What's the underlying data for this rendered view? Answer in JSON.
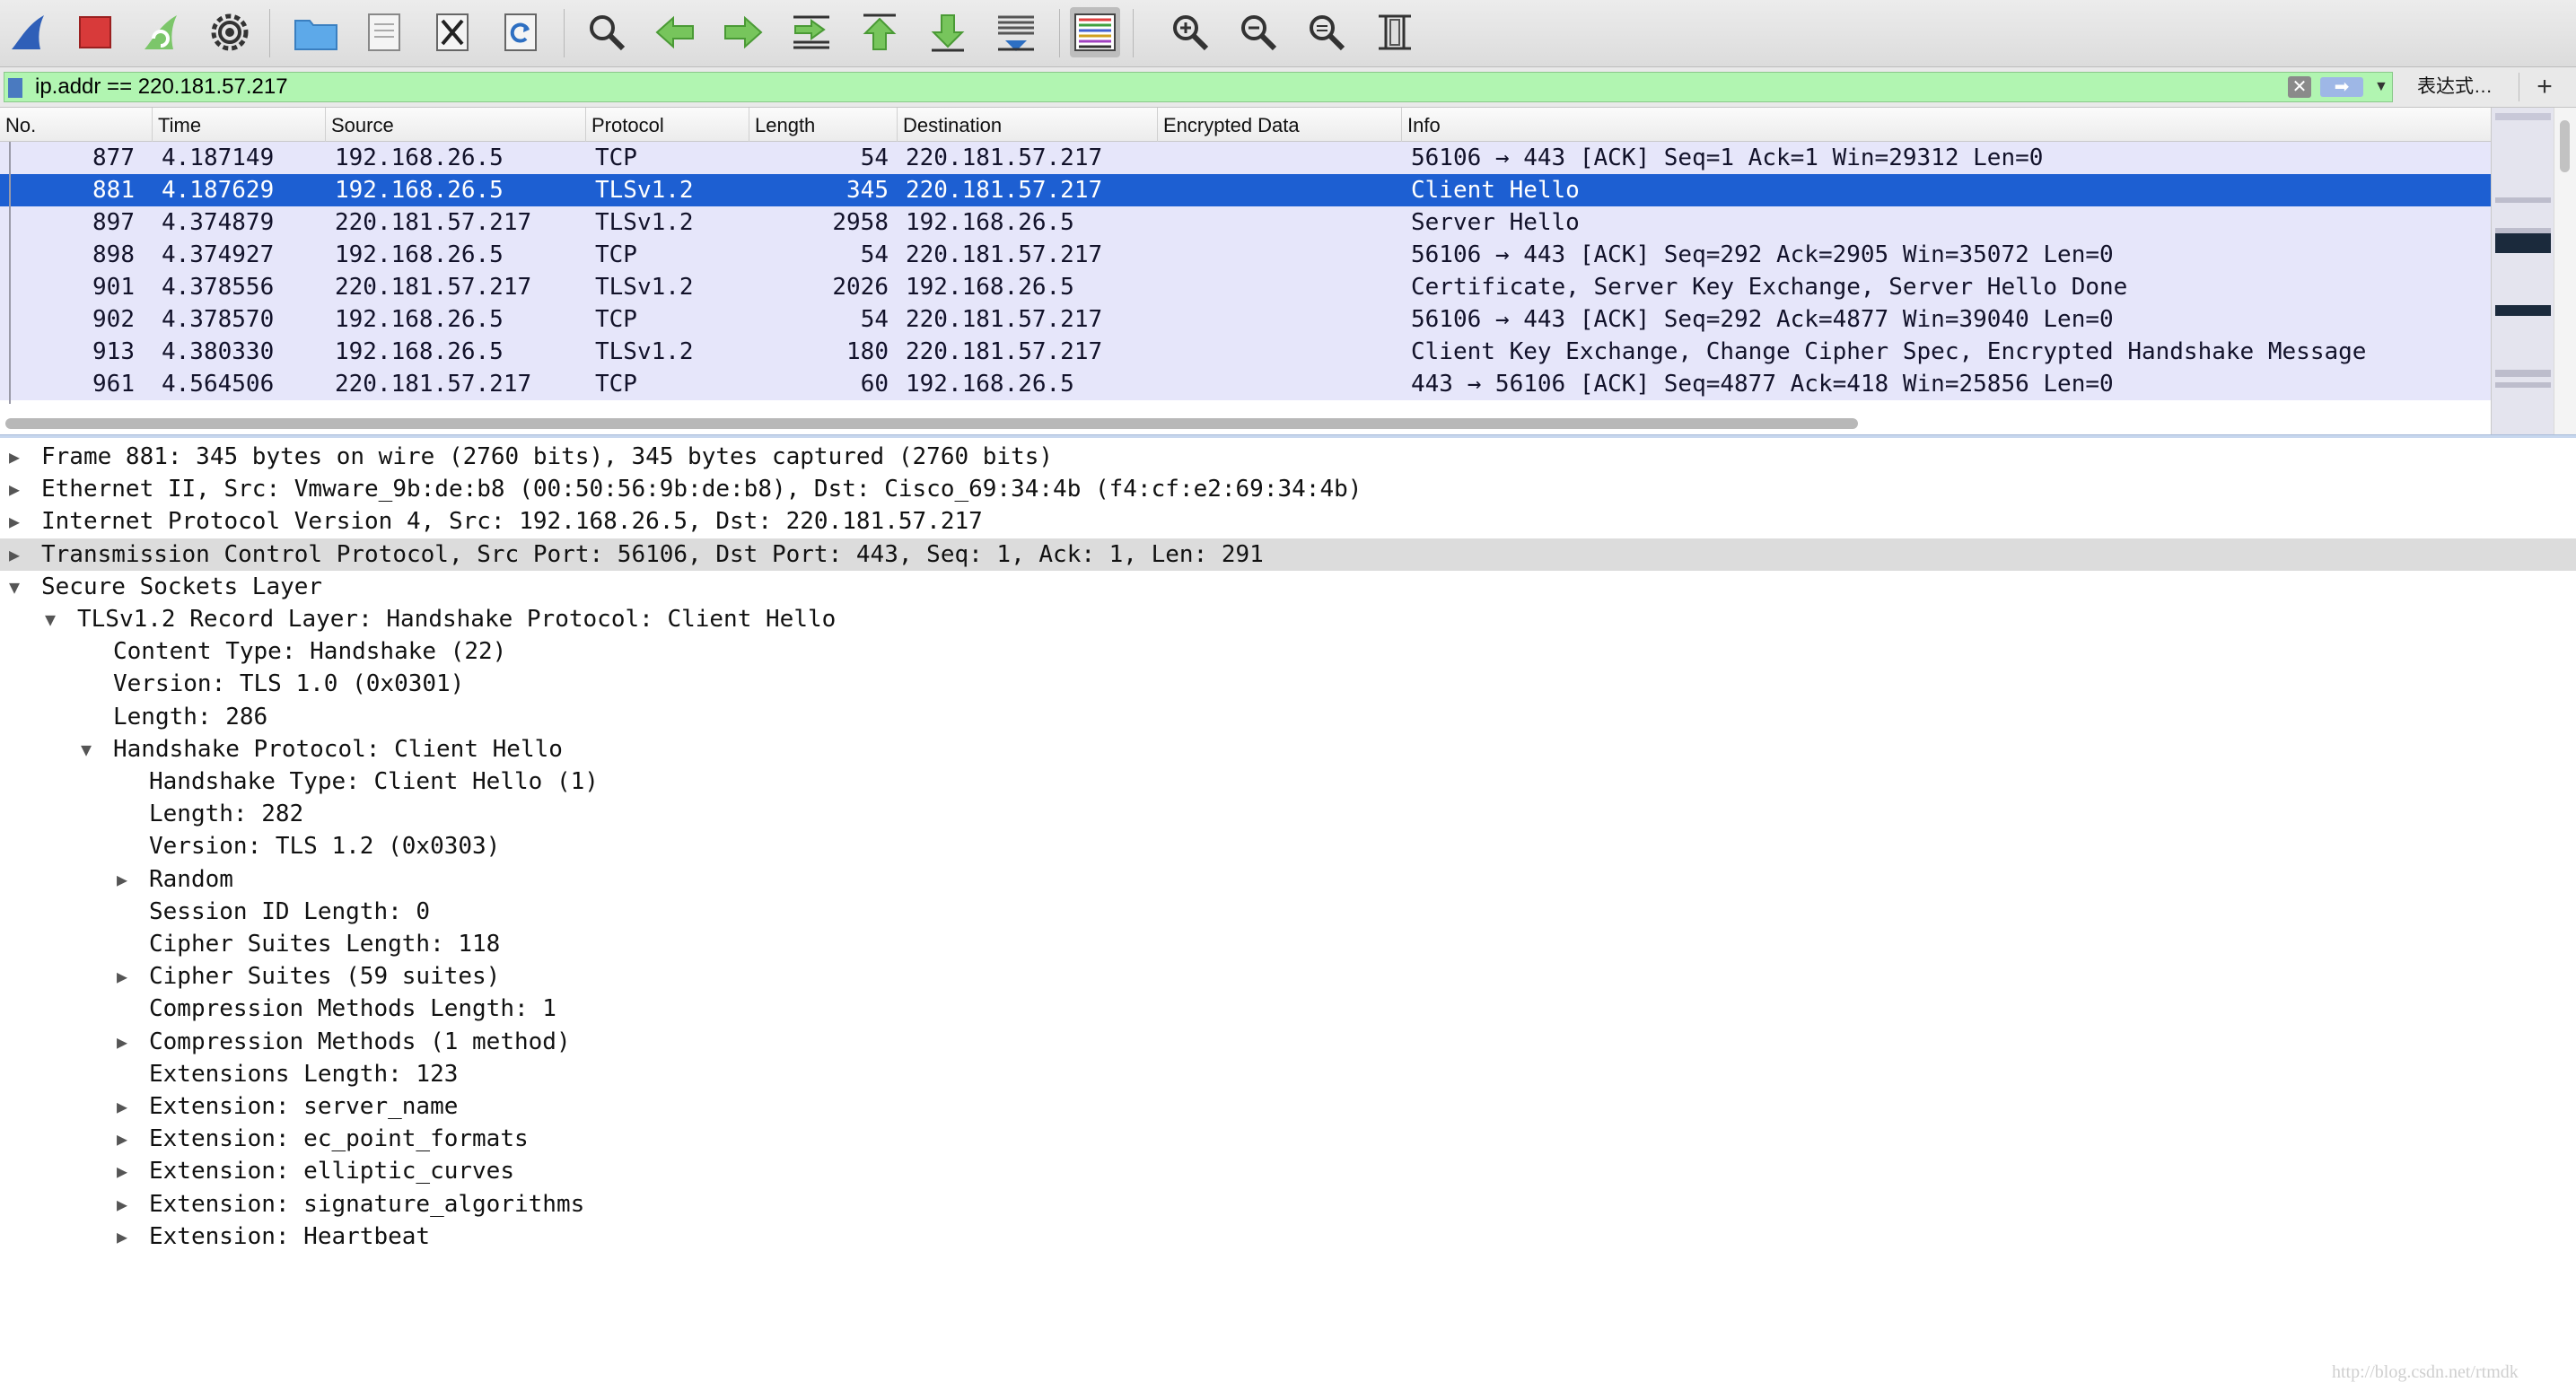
{
  "toolbar": {
    "buttons": [
      {
        "name": "start-capture-button",
        "icon": "shark-fin-icon"
      },
      {
        "name": "stop-capture-button",
        "icon": "stop-square-icon"
      },
      {
        "name": "restart-capture-button",
        "icon": "restart-fin-icon"
      },
      {
        "name": "capture-options-button",
        "icon": "gear-icon"
      },
      {
        "name": "open-file-button",
        "icon": "folder-icon"
      },
      {
        "name": "save-file-button",
        "icon": "document-icon"
      },
      {
        "name": "close-file-button",
        "icon": "close-document-icon"
      },
      {
        "name": "reload-file-button",
        "icon": "reload-icon"
      },
      {
        "name": "find-packet-button",
        "icon": "magnifier-icon"
      },
      {
        "name": "go-back-button",
        "icon": "arrow-left-icon"
      },
      {
        "name": "go-forward-button",
        "icon": "arrow-right-icon"
      },
      {
        "name": "go-to-packet-button",
        "icon": "jump-to-icon"
      },
      {
        "name": "first-packet-button",
        "icon": "arrow-up-icon"
      },
      {
        "name": "last-packet-button",
        "icon": "arrow-down-icon"
      },
      {
        "name": "autoscroll-button",
        "icon": "autoscroll-icon"
      },
      {
        "name": "colorize-button",
        "icon": "colorize-lines-icon"
      },
      {
        "name": "zoom-in-button",
        "icon": "zoom-in-icon"
      },
      {
        "name": "zoom-out-button",
        "icon": "zoom-out-icon"
      },
      {
        "name": "zoom-normal-button",
        "icon": "zoom-reset-icon"
      },
      {
        "name": "resize-columns-button",
        "icon": "resize-columns-icon"
      }
    ]
  },
  "filter": {
    "value": "ip.addr == 220.181.57.217",
    "expression_label": "表达式…",
    "add_label": "+"
  },
  "packet_list": {
    "columns": [
      "No.",
      "Time",
      "Source",
      "Protocol",
      "Length",
      "Destination",
      "Encrypted Data",
      "Info"
    ],
    "selected_index": 1,
    "rows": [
      {
        "no": "877",
        "time": "4.187149",
        "source": "192.168.26.5",
        "protocol": "TCP",
        "length": "54",
        "destination": "220.181.57.217",
        "encrypted": "",
        "info": "56106 → 443 [ACK] Seq=1 Ack=1 Win=29312 Len=0"
      },
      {
        "no": "881",
        "time": "4.187629",
        "source": "192.168.26.5",
        "protocol": "TLSv1.2",
        "length": "345",
        "destination": "220.181.57.217",
        "encrypted": "",
        "info": "Client Hello"
      },
      {
        "no": "897",
        "time": "4.374879",
        "source": "220.181.57.217",
        "protocol": "TLSv1.2",
        "length": "2958",
        "destination": "192.168.26.5",
        "encrypted": "",
        "info": "Server Hello"
      },
      {
        "no": "898",
        "time": "4.374927",
        "source": "192.168.26.5",
        "protocol": "TCP",
        "length": "54",
        "destination": "220.181.57.217",
        "encrypted": "",
        "info": "56106 → 443 [ACK] Seq=292 Ack=2905 Win=35072 Len=0"
      },
      {
        "no": "901",
        "time": "4.378556",
        "source": "220.181.57.217",
        "protocol": "TLSv1.2",
        "length": "2026",
        "destination": "192.168.26.5",
        "encrypted": "",
        "info": "Certificate, Server Key Exchange, Server Hello Done"
      },
      {
        "no": "902",
        "time": "4.378570",
        "source": "192.168.26.5",
        "protocol": "TCP",
        "length": "54",
        "destination": "220.181.57.217",
        "encrypted": "",
        "info": "56106 → 443 [ACK] Seq=292 Ack=4877 Win=39040 Len=0"
      },
      {
        "no": "913",
        "time": "4.380330",
        "source": "192.168.26.5",
        "protocol": "TLSv1.2",
        "length": "180",
        "destination": "220.181.57.217",
        "encrypted": "",
        "info": "Client Key Exchange, Change Cipher Spec, Encrypted Handshake Message"
      },
      {
        "no": "961",
        "time": "4.564506",
        "source": "220.181.57.217",
        "protocol": "TCP",
        "length": "60",
        "destination": "192.168.26.5",
        "encrypted": "",
        "info": "443 → 56106 [ACK] Seq=4877 Ack=418 Win=25856 Len=0"
      }
    ]
  },
  "details": [
    {
      "level": 0,
      "toggle": "collapsed",
      "text": "Frame 881: 345 bytes on wire (2760 bits), 345 bytes captured (2760 bits)"
    },
    {
      "level": 0,
      "toggle": "collapsed",
      "text": "Ethernet II, Src: Vmware_9b:de:b8 (00:50:56:9b:de:b8), Dst: Cisco_69:34:4b (f4:cf:e2:69:34:4b)"
    },
    {
      "level": 0,
      "toggle": "collapsed",
      "text": "Internet Protocol Version 4, Src: 192.168.26.5, Dst: 220.181.57.217"
    },
    {
      "level": 0,
      "toggle": "collapsed",
      "highlight": true,
      "text": "Transmission Control Protocol, Src Port: 56106, Dst Port: 443, Seq: 1, Ack: 1, Len: 291"
    },
    {
      "level": 0,
      "toggle": "expanded",
      "text": "Secure Sockets Layer"
    },
    {
      "level": 1,
      "toggle": "expanded",
      "text": "TLSv1.2 Record Layer: Handshake Protocol: Client Hello"
    },
    {
      "level": 2,
      "toggle": "none",
      "text": "Content Type: Handshake (22)"
    },
    {
      "level": 2,
      "toggle": "none",
      "text": "Version: TLS 1.0 (0x0301)"
    },
    {
      "level": 2,
      "toggle": "none",
      "text": "Length: 286"
    },
    {
      "level": 2,
      "toggle": "expanded",
      "text": "Handshake Protocol: Client Hello"
    },
    {
      "level": 3,
      "toggle": "none",
      "text": "Handshake Type: Client Hello (1)"
    },
    {
      "level": 3,
      "toggle": "none",
      "text": "Length: 282"
    },
    {
      "level": 3,
      "toggle": "none",
      "text": "Version: TLS 1.2 (0x0303)"
    },
    {
      "level": 3,
      "toggle": "collapsed",
      "text": "Random"
    },
    {
      "level": 3,
      "toggle": "none",
      "text": "Session ID Length: 0"
    },
    {
      "level": 3,
      "toggle": "none",
      "text": "Cipher Suites Length: 118"
    },
    {
      "level": 3,
      "toggle": "collapsed",
      "text": "Cipher Suites (59 suites)"
    },
    {
      "level": 3,
      "toggle": "none",
      "text": "Compression Methods Length: 1"
    },
    {
      "level": 3,
      "toggle": "collapsed",
      "text": "Compression Methods (1 method)"
    },
    {
      "level": 3,
      "toggle": "none",
      "text": "Extensions Length: 123"
    },
    {
      "level": 3,
      "toggle": "collapsed",
      "text": "Extension: server_name"
    },
    {
      "level": 3,
      "toggle": "collapsed",
      "text": "Extension: ec_point_formats"
    },
    {
      "level": 3,
      "toggle": "collapsed",
      "text": "Extension: elliptic_curves"
    },
    {
      "level": 3,
      "toggle": "collapsed",
      "text": "Extension: signature_algorithms"
    },
    {
      "level": 3,
      "toggle": "collapsed",
      "text": "Extension: Heartbeat"
    }
  ],
  "watermark": "http://blog.csdn.net/rtmdk",
  "colors": {
    "row_bg": "#e6e6fa",
    "row_selected_bg": "#1d5fd2",
    "filter_valid_bg": "#b1f5b1",
    "detail_highlight_bg": "#dcdcdc"
  }
}
